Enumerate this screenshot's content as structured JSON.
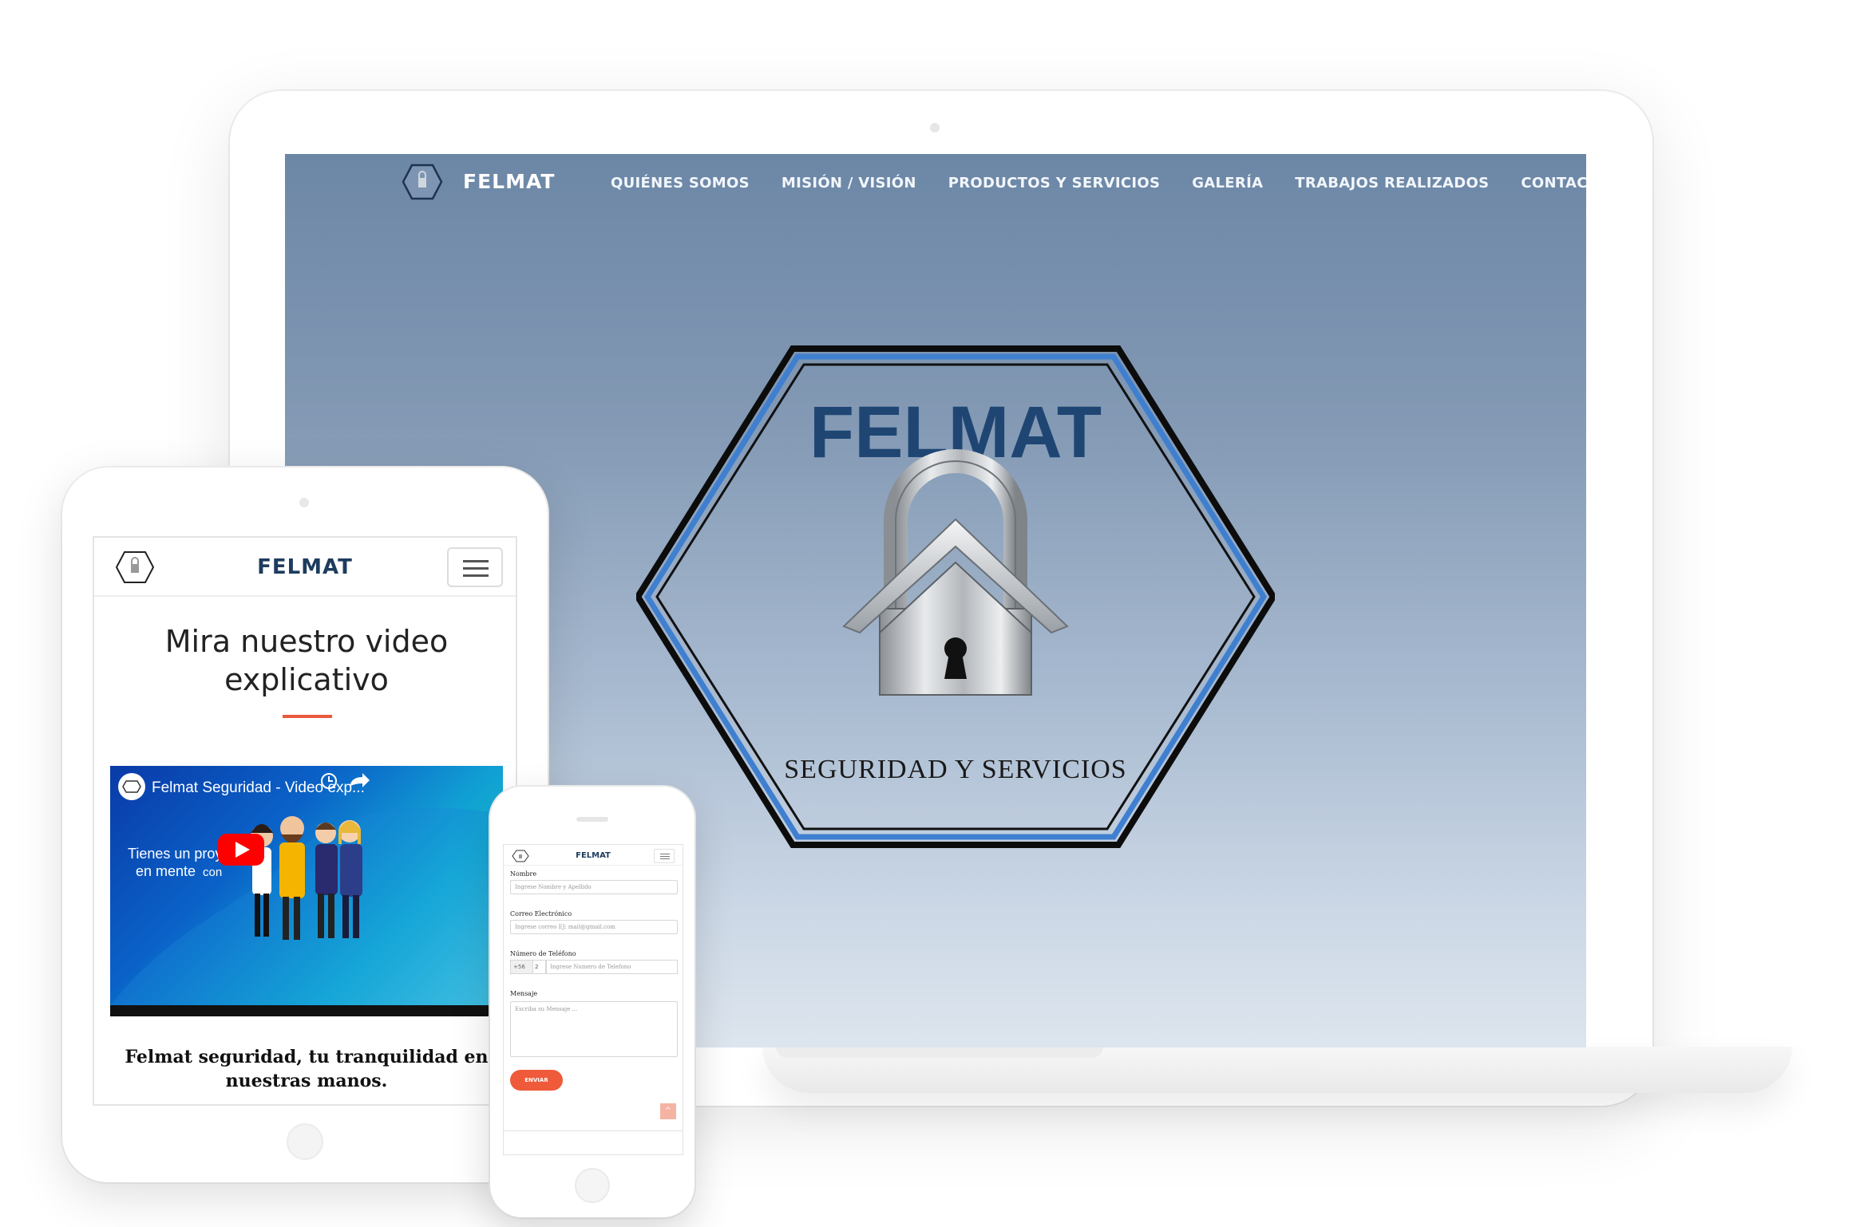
{
  "desktop": {
    "brand": "FELMAT",
    "menu": [
      {
        "label": "QUIÉNES SOMOS"
      },
      {
        "label": "MISIÓN / VISIÓN"
      },
      {
        "label": "PRODUCTOS Y SERVICIOS"
      },
      {
        "label": "GALERÍA"
      },
      {
        "label": "TRABAJOS REALIZADOS"
      },
      {
        "label": "CONTACTO"
      }
    ],
    "hero": {
      "logo_title": "FELMAT",
      "logo_subtitle": "SEGURIDAD Y SERVICIOS"
    }
  },
  "tablet": {
    "brand": "FELMAT",
    "heading": "Mira nuestro video explicativo",
    "video": {
      "title": "Felmat Seguridad - Video exp...",
      "overlay_line1": "Tienes un proyecto",
      "overlay_line2": "en mente",
      "overlay_word": "con"
    },
    "caption": "Felmat seguridad, tu tranquilidad en nuestras manos."
  },
  "phone": {
    "brand": "FELMAT",
    "form": {
      "name_label": "Nombre",
      "name_placeholder": "Ingrese Nombre y Apellido",
      "email_label": "Correo Electrónico",
      "email_placeholder": "Ingrese correo EJ: mail@gmail.com",
      "phone_label": "Número de Teléfono",
      "country_code": "+56",
      "area_code": "2",
      "phone_placeholder": "Ingrese Numero de Telefono",
      "message_label": "Mensaje",
      "message_placeholder": "Escriba su Mensaje ...",
      "submit_label": "ENVIAR"
    }
  },
  "colors": {
    "brand_navy": "#1d3c5e",
    "accent_orange": "#ee5a3a",
    "hero_top": "#6c87a6",
    "hero_bottom": "#dde5ee",
    "logo_blue": "#2f6fc0"
  }
}
